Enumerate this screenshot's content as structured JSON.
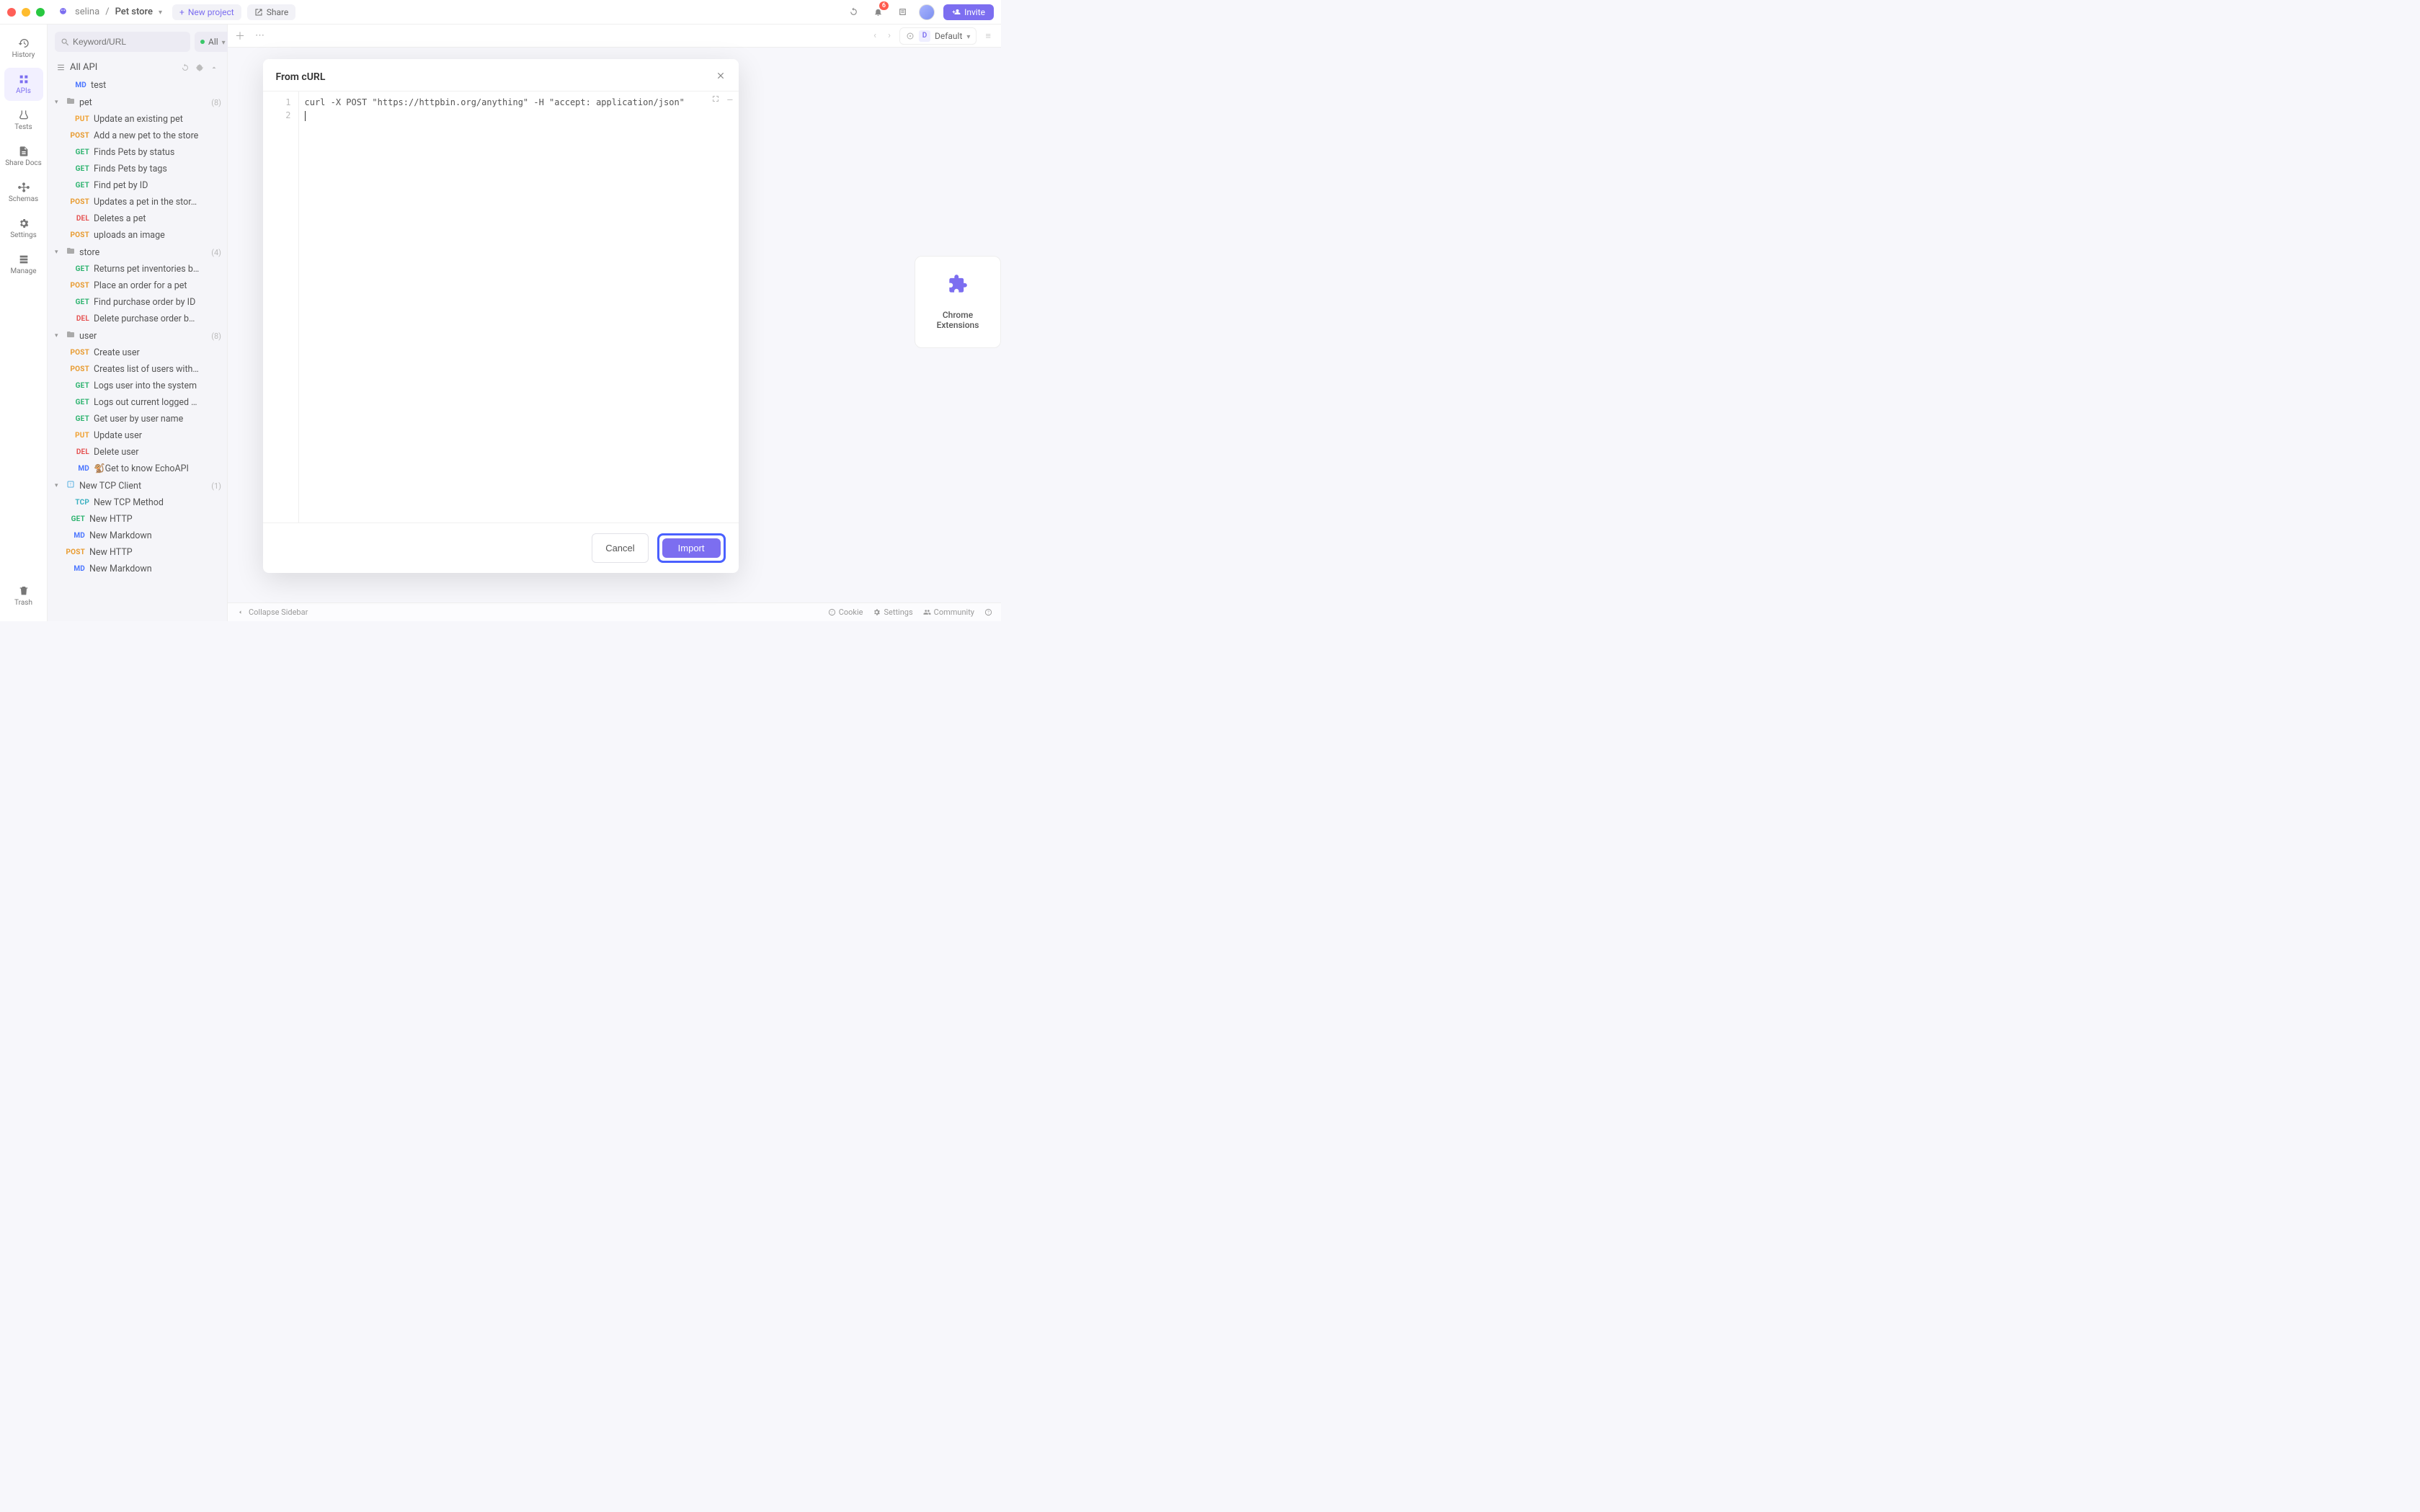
{
  "titlebar": {
    "workspace": "selina",
    "project": "Pet store",
    "new_project": "New project",
    "share": "Share",
    "notif_count": "6",
    "invite": "Invite"
  },
  "rail": {
    "history": "History",
    "apis": "APIs",
    "tests": "Tests",
    "sharedocs": "Share Docs",
    "schemas": "Schemas",
    "settings": "Settings",
    "manage": "Manage",
    "trash": "Trash"
  },
  "sidebar": {
    "search_placeholder": "Keyword/URL",
    "filter_label": "All",
    "all_api": "All API",
    "items": [
      {
        "method": "MD",
        "name": "test"
      },
      {
        "folder": true,
        "name": "pet",
        "count": "(8)",
        "children": [
          {
            "method": "PUT",
            "name": "Update an existing pet"
          },
          {
            "method": "POST",
            "name": "Add a new pet to the store"
          },
          {
            "method": "GET",
            "name": "Finds Pets by status"
          },
          {
            "method": "GET",
            "name": "Finds Pets by tags"
          },
          {
            "method": "GET",
            "name": "Find pet by ID"
          },
          {
            "method": "POST",
            "name": "Updates a pet in the stor…"
          },
          {
            "method": "DEL",
            "name": "Deletes a pet"
          },
          {
            "method": "POST",
            "name": "uploads an image"
          }
        ]
      },
      {
        "folder": true,
        "name": "store",
        "count": "(4)",
        "children": [
          {
            "method": "GET",
            "name": "Returns pet inventories b…"
          },
          {
            "method": "POST",
            "name": "Place an order for a pet"
          },
          {
            "method": "GET",
            "name": "Find purchase order by ID"
          },
          {
            "method": "DEL",
            "name": "Delete purchase order b…"
          }
        ]
      },
      {
        "folder": true,
        "name": "user",
        "count": "(8)",
        "children": [
          {
            "method": "POST",
            "name": "Create user"
          },
          {
            "method": "POST",
            "name": "Creates list of users with…"
          },
          {
            "method": "GET",
            "name": "Logs user into the system"
          },
          {
            "method": "GET",
            "name": "Logs out current logged …"
          },
          {
            "method": "GET",
            "name": "Get user by user name"
          },
          {
            "method": "PUT",
            "name": "Update user"
          },
          {
            "method": "DEL",
            "name": "Delete user"
          },
          {
            "method": "MD",
            "name": "🐒Get to know EchoAPI"
          }
        ]
      },
      {
        "folder": true,
        "tcp": true,
        "name": "New TCP Client",
        "count": "(1)",
        "children": [
          {
            "method": "TCP",
            "name": "New TCP Method"
          }
        ]
      },
      {
        "method": "GET",
        "name": "New HTTP",
        "level": 2
      },
      {
        "method": "MD",
        "name": "New Markdown",
        "level": 2
      },
      {
        "method": "POST",
        "name": "New HTTP",
        "level": 2
      },
      {
        "method": "MD",
        "name": "New Markdown",
        "level": 2
      }
    ]
  },
  "env": {
    "label": "Default"
  },
  "ext_card": {
    "label": "Chrome Extensions"
  },
  "statusbar": {
    "collapse": "Collapse Sidebar",
    "cookie": "Cookie",
    "settings": "Settings",
    "community": "Community"
  },
  "modal": {
    "title": "From cURL",
    "code": "curl -X POST \"https://httpbin.org/anything\" -H \"accept: application/json\"",
    "line1": "1",
    "line2": "2",
    "cancel": "Cancel",
    "import": "Import"
  }
}
